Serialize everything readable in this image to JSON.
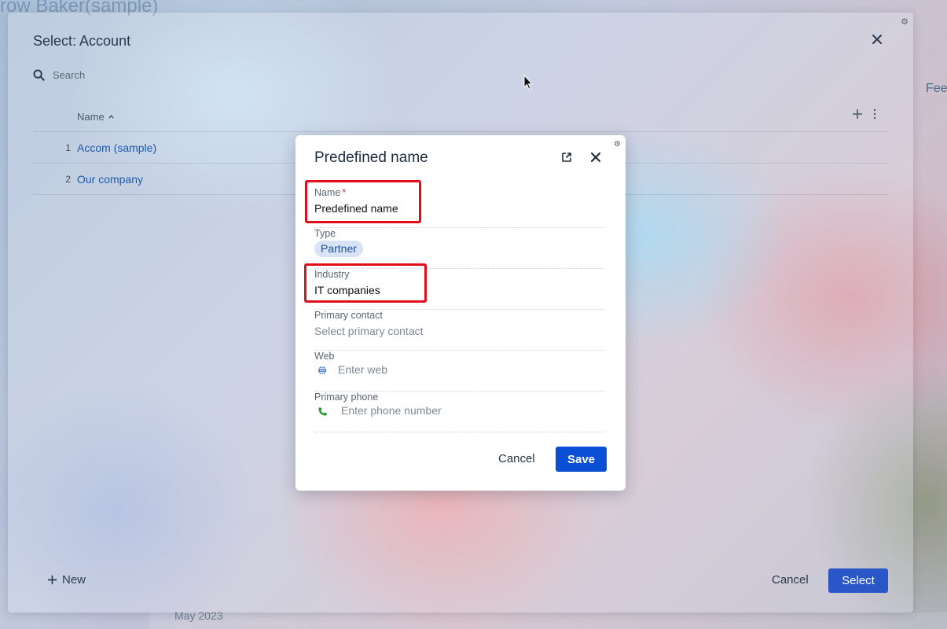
{
  "background": {
    "page_title_fragment": "row Baker(sample)",
    "date_fragment": "May 2023",
    "right_label_fragment": "Fee"
  },
  "account_modal": {
    "title": "Select: Account",
    "search_placeholder": "Search",
    "column_name_label": "Name",
    "rows": [
      {
        "num": "1",
        "name": "Accom (sample)"
      },
      {
        "num": "2",
        "name": "Our company"
      }
    ],
    "new_label": "New",
    "cancel_label": "Cancel",
    "select_label": "Select"
  },
  "dialog": {
    "title": "Predefined name",
    "fields": {
      "name": {
        "label": "Name",
        "required_mark": "*",
        "value": "Predefined name"
      },
      "type": {
        "label": "Type",
        "value": "Partner"
      },
      "industry": {
        "label": "Industry",
        "value": "IT companies"
      },
      "primary_contact": {
        "label": "Primary contact",
        "placeholder": "Select primary contact"
      },
      "web": {
        "label": "Web",
        "placeholder": "Enter web"
      },
      "primary_phone": {
        "label": "Primary phone",
        "placeholder": "Enter phone number"
      }
    },
    "cancel_label": "Cancel",
    "save_label": "Save"
  },
  "colors": {
    "primary_button": "#0b4fd6",
    "select_button": "#2957c8",
    "link": "#1c5ab0",
    "highlight": "#e10d19",
    "chip_bg": "#d8e4f6"
  },
  "icons": [
    "gear-icon",
    "close-icon",
    "search-icon",
    "sort-asc-icon",
    "plus-icon",
    "kebab-menu-icon",
    "open-external-icon",
    "globe-icon",
    "phone-icon",
    "mouse-cursor-icon"
  ]
}
